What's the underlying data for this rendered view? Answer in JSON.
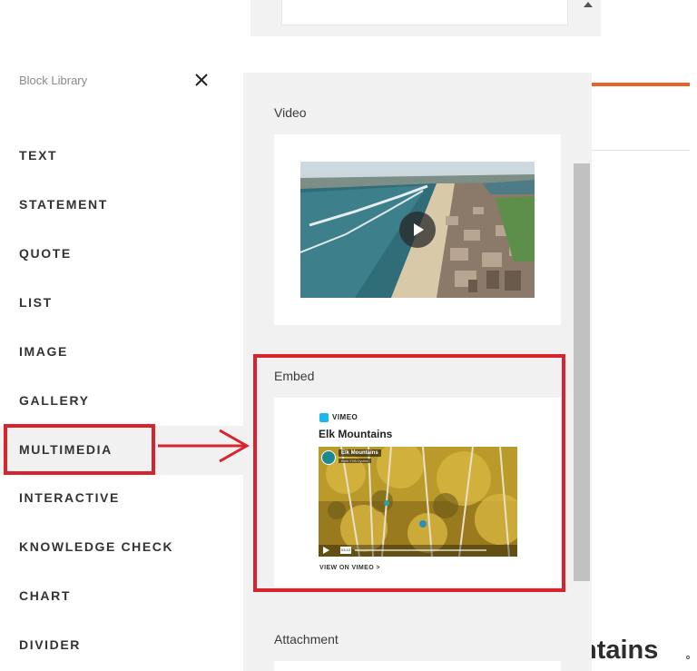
{
  "sidebar": {
    "title": "Block Library",
    "items": [
      {
        "label": "TEXT"
      },
      {
        "label": "STATEMENT"
      },
      {
        "label": "QUOTE"
      },
      {
        "label": "LIST"
      },
      {
        "label": "IMAGE"
      },
      {
        "label": "GALLERY"
      },
      {
        "label": "MULTIMEDIA",
        "active": true
      },
      {
        "label": "INTERACTIVE"
      },
      {
        "label": "KNOWLEDGE CHECK"
      },
      {
        "label": "CHART"
      },
      {
        "label": "DIVIDER"
      }
    ]
  },
  "panel": {
    "cards": [
      {
        "label": "Video"
      },
      {
        "label": "Embed"
      },
      {
        "label": "Attachment"
      }
    ],
    "embed_preview": {
      "brand": "VIMEO",
      "title": "Elk Mountains",
      "overlay_title": "Elk Mountains",
      "overlay_sub": "from YVA Cycles",
      "time": "03:10",
      "link_text": "VIEW ON VIMEO  >"
    }
  },
  "background": {
    "heading_fragment": "ntains"
  },
  "colors": {
    "highlight": "#d6252f",
    "accent_orange": "#e8632b",
    "vimeo_blue": "#1ab7ea"
  },
  "icons": {
    "close": "close-icon",
    "play": "play-icon",
    "arrow": "arrow-right-icon"
  }
}
